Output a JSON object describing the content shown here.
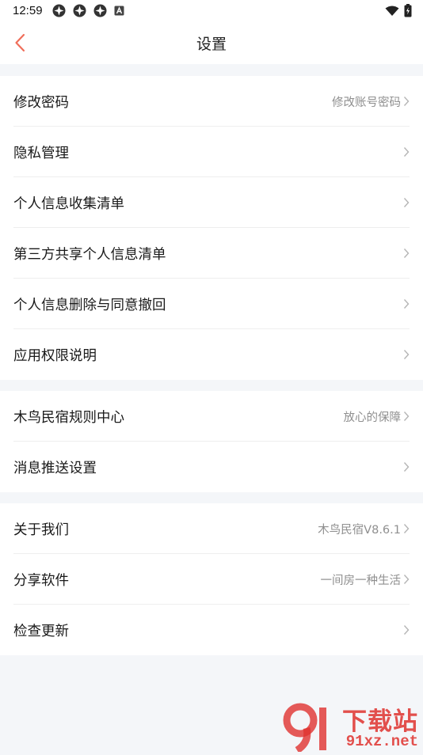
{
  "status_bar": {
    "time": "12:59",
    "left_icons": [
      "app-notification-icon",
      "app-notification-icon",
      "app-notification-icon",
      "keyboard-a-icon"
    ],
    "right_icons": [
      "wifi-icon",
      "battery-charging-icon"
    ]
  },
  "nav": {
    "title": "设置",
    "back_icon": "chevron-left-icon"
  },
  "sections": [
    {
      "items": [
        {
          "label": "修改密码",
          "value": "修改账号密码"
        },
        {
          "label": "隐私管理",
          "value": ""
        },
        {
          "label": "个人信息收集清单",
          "value": ""
        },
        {
          "label": "第三方共享个人信息清单",
          "value": ""
        },
        {
          "label": "个人信息删除与同意撤回",
          "value": ""
        },
        {
          "label": "应用权限说明",
          "value": ""
        }
      ]
    },
    {
      "items": [
        {
          "label": "木鸟民宿规则中心",
          "value": "放心的保障"
        },
        {
          "label": "消息推送设置",
          "value": ""
        }
      ]
    },
    {
      "items": [
        {
          "label": "关于我们",
          "value": "木鸟民宿V8.6.1"
        },
        {
          "label": "分享软件",
          "value": "一间房一种生活"
        },
        {
          "label": "检查更新",
          "value": ""
        }
      ]
    }
  ],
  "watermark": {
    "top": "下载站",
    "bottom": "91xz.net"
  },
  "colors": {
    "accent": "#f06e5a",
    "background": "#f4f6f9",
    "divider": "#eeeeee",
    "secondary_text": "#8f8f8f",
    "watermark": "#e0322f"
  }
}
